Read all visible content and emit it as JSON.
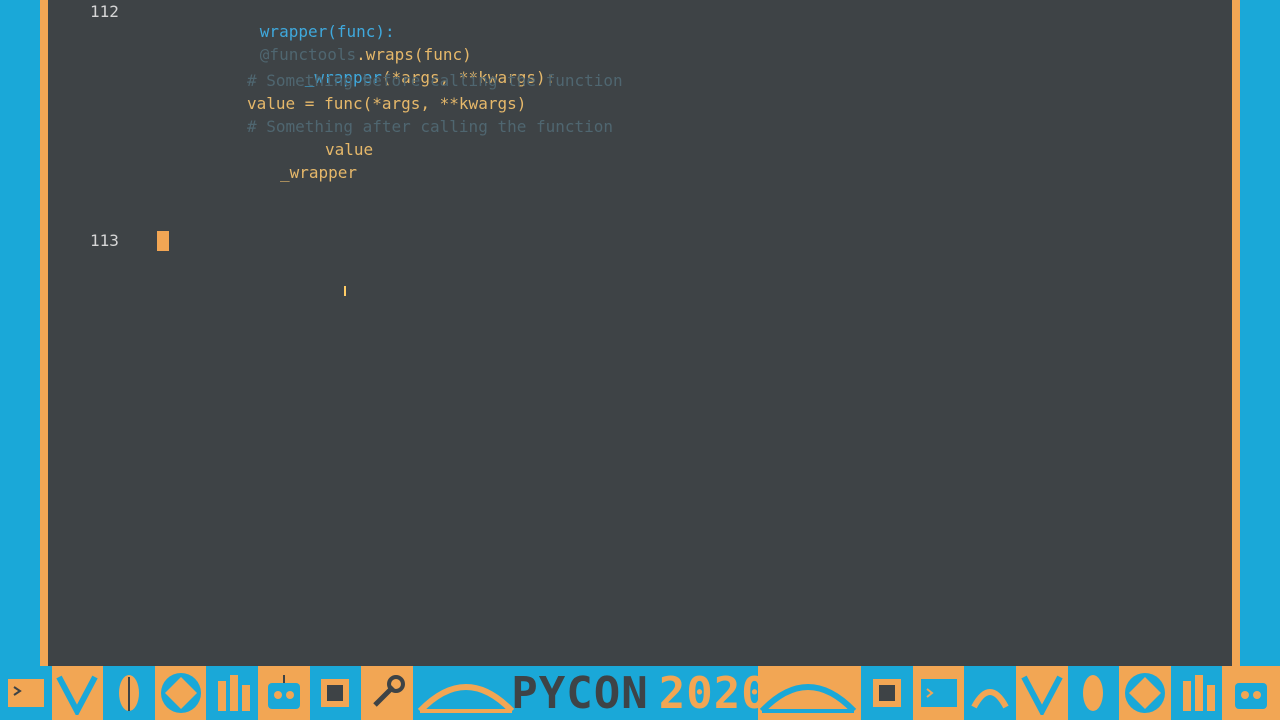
{
  "editor": {
    "line_numbers": [
      "112",
      "113"
    ],
    "code": {
      "def_line": "wrapper(func):",
      "decorator_faint": "@functools",
      "decorator_tail": ".wraps(func)",
      "inner_def": "_wrapper",
      "inner_args": "(*args, **kwargs):",
      "comment_before": "# Something before calling the function",
      "value_line": "value = func(*args, **kwargs)",
      "comment_after": "# Something after calling the function",
      "return_value": "value",
      "return_wrapper": "_wrapper"
    }
  },
  "banner": {
    "title": "PYCON",
    "year": "2020",
    "icons": [
      "terminal-snake-icon",
      "pennant-icon",
      "leaf-icon",
      "diamond-icon",
      "tower-icon",
      "robot-icon",
      "chip-icon",
      "wrench-icon",
      "bridge-icon",
      "snake-icon"
    ]
  },
  "colors": {
    "background": "#1ba6d6",
    "editor_bg": "#3e4346",
    "accent": "#f2a654",
    "keyword": "#3fa9dd",
    "text": "#e6b86a"
  }
}
